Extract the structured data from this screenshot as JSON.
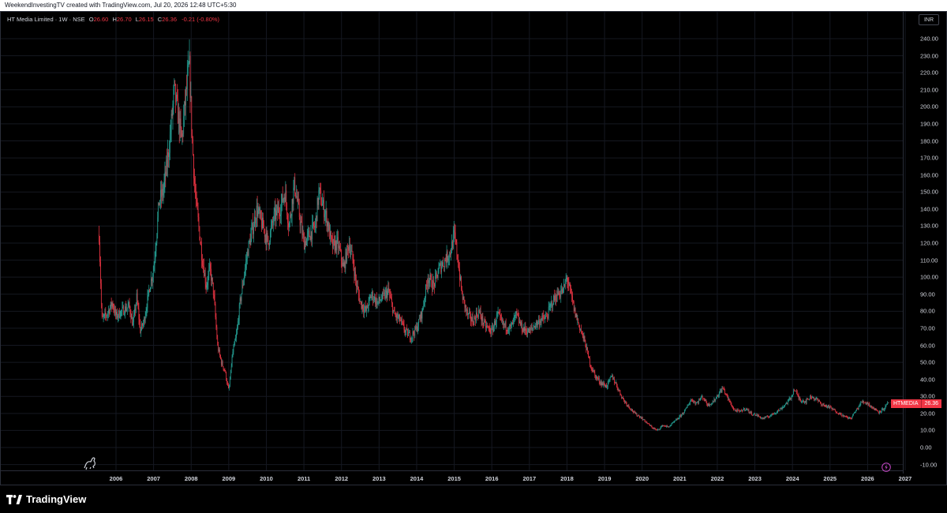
{
  "header": {
    "text": "WeekendInvestingTV created with TradingView.com, Jul 20, 2026 12:48 UTC+5:30"
  },
  "legend": {
    "symbol": "HT Media Limited · 1W · NSE",
    "open_label": "O",
    "open": "26.60",
    "high_label": "H",
    "high": "26.70",
    "low_label": "L",
    "low": "26.15",
    "close_label": "C",
    "close": "26.36",
    "change": "-0.21 (-0.80%)"
  },
  "currency": "INR",
  "last_price": {
    "name": "HTMEDIA",
    "price": "26.36"
  },
  "footer": {
    "brand": "TradingView"
  },
  "colors": {
    "up": "#26a69a",
    "down": "#f23645",
    "grid": "#151821",
    "background": "#000000"
  },
  "icons": {
    "logo": "tradingview-logo-icon",
    "dino": "dino-icon",
    "flash": "flash-icon"
  },
  "chart_data": {
    "type": "candlestick",
    "timeframe": "1W",
    "y_ticks": [
      "240.00",
      "230.00",
      "220.00",
      "210.00",
      "200.00",
      "190.00",
      "180.00",
      "170.00",
      "160.00",
      "150.00",
      "140.00",
      "130.00",
      "120.00",
      "110.00",
      "100.00",
      "90.00",
      "80.00",
      "70.00",
      "60.00",
      "50.00",
      "40.00",
      "30.00",
      "20.00",
      "10.00",
      "0.00",
      "-10.00"
    ],
    "x_ticks": [
      "2006",
      "2007",
      "2008",
      "2009",
      "2010",
      "2011",
      "2012",
      "2013",
      "2014",
      "2015",
      "2016",
      "2017",
      "2018",
      "2019",
      "2020",
      "2021",
      "2022",
      "2023",
      "2024",
      "2025",
      "2026",
      "2027"
    ],
    "ylim": [
      -10,
      240
    ],
    "xlim": [
      2005.2,
      2027.0
    ],
    "price_path": [
      [
        2005.55,
        125
      ],
      [
        2005.62,
        75
      ],
      [
        2005.75,
        78
      ],
      [
        2005.9,
        85
      ],
      [
        2006.0,
        77
      ],
      [
        2006.15,
        80
      ],
      [
        2006.35,
        83
      ],
      [
        2006.45,
        72
      ],
      [
        2006.55,
        88
      ],
      [
        2006.65,
        68
      ],
      [
        2006.75,
        75
      ],
      [
        2006.9,
        95
      ],
      [
        2007.0,
        105
      ],
      [
        2007.15,
        145
      ],
      [
        2007.25,
        150
      ],
      [
        2007.35,
        165
      ],
      [
        2007.45,
        185
      ],
      [
        2007.55,
        210
      ],
      [
        2007.65,
        195
      ],
      [
        2007.75,
        180
      ],
      [
        2007.85,
        205
      ],
      [
        2007.95,
        225
      ],
      [
        2008.02,
        185
      ],
      [
        2008.1,
        150
      ],
      [
        2008.2,
        130
      ],
      [
        2008.3,
        110
      ],
      [
        2008.4,
        95
      ],
      [
        2008.5,
        105
      ],
      [
        2008.6,
        90
      ],
      [
        2008.7,
        60
      ],
      [
        2008.8,
        50
      ],
      [
        2008.9,
        45
      ],
      [
        2009.0,
        33
      ],
      [
        2009.1,
        55
      ],
      [
        2009.2,
        65
      ],
      [
        2009.3,
        85
      ],
      [
        2009.4,
        100
      ],
      [
        2009.5,
        115
      ],
      [
        2009.6,
        125
      ],
      [
        2009.75,
        140
      ],
      [
        2009.9,
        130
      ],
      [
        2010.05,
        120
      ],
      [
        2010.2,
        135
      ],
      [
        2010.35,
        140
      ],
      [
        2010.5,
        150
      ],
      [
        2010.6,
        130
      ],
      [
        2010.75,
        155
      ],
      [
        2010.85,
        140
      ],
      [
        2011.0,
        120
      ],
      [
        2011.15,
        125
      ],
      [
        2011.3,
        130
      ],
      [
        2011.4,
        150
      ],
      [
        2011.5,
        142
      ],
      [
        2011.6,
        135
      ],
      [
        2011.75,
        118
      ],
      [
        2011.9,
        120
      ],
      [
        2012.05,
        105
      ],
      [
        2012.2,
        120
      ],
      [
        2012.3,
        110
      ],
      [
        2012.4,
        95
      ],
      [
        2012.5,
        85
      ],
      [
        2012.65,
        80
      ],
      [
        2012.8,
        90
      ],
      [
        2012.95,
        85
      ],
      [
        2013.1,
        88
      ],
      [
        2013.25,
        92
      ],
      [
        2013.4,
        78
      ],
      [
        2013.55,
        75
      ],
      [
        2013.7,
        68
      ],
      [
        2013.85,
        65
      ],
      [
        2014.0,
        70
      ],
      [
        2014.15,
        80
      ],
      [
        2014.3,
        100
      ],
      [
        2014.45,
        95
      ],
      [
        2014.6,
        105
      ],
      [
        2014.75,
        110
      ],
      [
        2014.9,
        115
      ],
      [
        2015.0,
        125
      ],
      [
        2015.1,
        110
      ],
      [
        2015.2,
        90
      ],
      [
        2015.35,
        78
      ],
      [
        2015.5,
        74
      ],
      [
        2015.65,
        80
      ],
      [
        2015.8,
        72
      ],
      [
        2016.0,
        68
      ],
      [
        2016.15,
        78
      ],
      [
        2016.3,
        72
      ],
      [
        2016.5,
        70
      ],
      [
        2016.65,
        78
      ],
      [
        2016.8,
        70
      ],
      [
        2017.0,
        68
      ],
      [
        2017.15,
        72
      ],
      [
        2017.3,
        75
      ],
      [
        2017.45,
        76
      ],
      [
        2017.6,
        85
      ],
      [
        2017.75,
        90
      ],
      [
        2017.9,
        92
      ],
      [
        2018.0,
        100
      ],
      [
        2018.1,
        90
      ],
      [
        2018.2,
        80
      ],
      [
        2018.35,
        70
      ],
      [
        2018.5,
        60
      ],
      [
        2018.6,
        50
      ],
      [
        2018.75,
        42
      ],
      [
        2018.9,
        38
      ],
      [
        2019.05,
        36
      ],
      [
        2019.2,
        42
      ],
      [
        2019.35,
        35
      ],
      [
        2019.5,
        28
      ],
      [
        2019.65,
        24
      ],
      [
        2019.8,
        20
      ],
      [
        2019.95,
        18
      ],
      [
        2020.1,
        15
      ],
      [
        2020.25,
        12
      ],
      [
        2020.4,
        10
      ],
      [
        2020.55,
        13
      ],
      [
        2020.7,
        12
      ],
      [
        2020.85,
        15
      ],
      [
        2021.0,
        18
      ],
      [
        2021.15,
        22
      ],
      [
        2021.3,
        28
      ],
      [
        2021.45,
        26
      ],
      [
        2021.6,
        30
      ],
      [
        2021.75,
        25
      ],
      [
        2021.9,
        27
      ],
      [
        2022.05,
        32
      ],
      [
        2022.15,
        35
      ],
      [
        2022.3,
        28
      ],
      [
        2022.45,
        22
      ],
      [
        2022.6,
        21
      ],
      [
        2022.75,
        23
      ],
      [
        2022.9,
        20
      ],
      [
        2023.05,
        19
      ],
      [
        2023.2,
        17
      ],
      [
        2023.35,
        18
      ],
      [
        2023.5,
        20
      ],
      [
        2023.65,
        22
      ],
      [
        2023.8,
        25
      ],
      [
        2023.95,
        29
      ],
      [
        2024.05,
        34
      ],
      [
        2024.2,
        28
      ],
      [
        2024.35,
        27
      ],
      [
        2024.5,
        30
      ],
      [
        2024.65,
        28
      ],
      [
        2024.8,
        25
      ],
      [
        2024.95,
        24
      ],
      [
        2025.1,
        22
      ],
      [
        2025.25,
        20
      ],
      [
        2025.4,
        18
      ],
      [
        2025.55,
        17
      ],
      [
        2025.7,
        22
      ],
      [
        2025.85,
        27
      ],
      [
        2026.0,
        26
      ],
      [
        2026.15,
        23
      ],
      [
        2026.3,
        21
      ],
      [
        2026.45,
        23
      ],
      [
        2026.55,
        26.36
      ]
    ],
    "last_close": 26.36
  }
}
